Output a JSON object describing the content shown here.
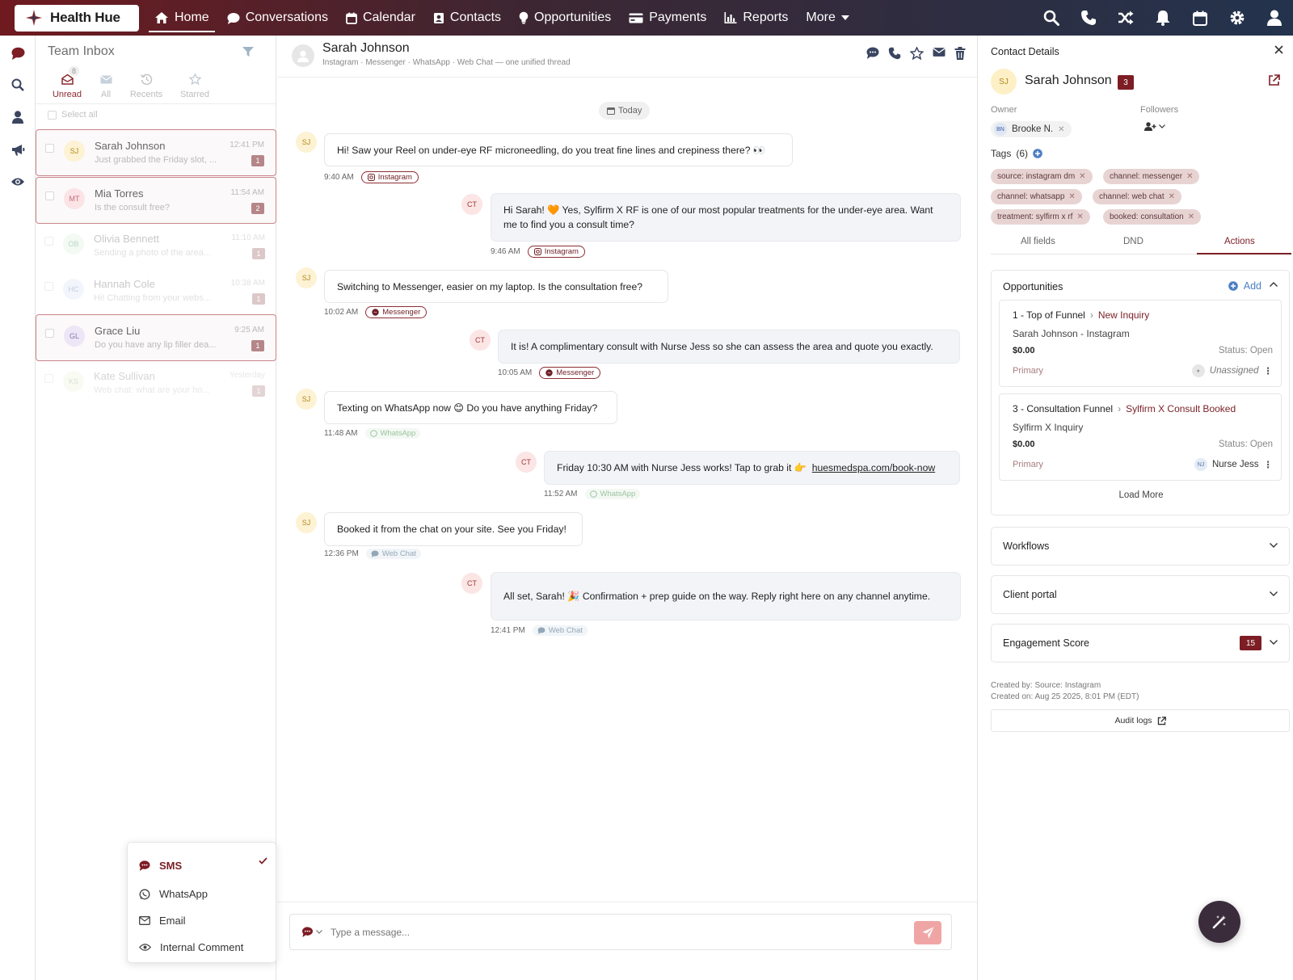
{
  "app": {
    "name": "Health Hue"
  },
  "nav": [
    {
      "label": "Home",
      "icon": "home-icon",
      "active": true
    },
    {
      "label": "Conversations",
      "icon": "chat-icon"
    },
    {
      "label": "Calendar",
      "icon": "calendar-icon"
    },
    {
      "label": "Contacts",
      "icon": "contacts-icon"
    },
    {
      "label": "Opportunities",
      "icon": "lightbulb-icon"
    },
    {
      "label": "Payments",
      "icon": "card-icon"
    },
    {
      "label": "Reports",
      "icon": "chart-icon"
    },
    {
      "label": "More",
      "icon": "caret-down-icon"
    }
  ],
  "inbox": {
    "title": "Team Inbox",
    "tabs": [
      {
        "label": "Unread",
        "badge": "8",
        "active": true
      },
      {
        "label": "All"
      },
      {
        "label": "Recents"
      },
      {
        "label": "Starred"
      }
    ],
    "select_all": "Select all",
    "conversations": [
      {
        "initials": "SJ",
        "name": "Sarah Johnson",
        "preview": "Just grabbed the Friday slot, ...",
        "time": "12:41 PM",
        "count": "1",
        "av_bg": "#fdf2d3",
        "av_fg": "#b08a1d"
      },
      {
        "initials": "MT",
        "name": "Mia Torres",
        "preview": "Is the consult free?",
        "time": "11:54 AM",
        "count": "2",
        "av_bg": "#fbe3e6",
        "av_fg": "#c26b78"
      },
      {
        "initials": "OB",
        "name": "Olivia Bennett",
        "preview": "Sending a photo of the area...",
        "time": "11:10 AM",
        "count": "1",
        "av_bg": "#e3f4e6",
        "av_fg": "#6aa57a"
      },
      {
        "initials": "HC",
        "name": "Hannah Cole",
        "preview": "Hi! Chatting from your webs...",
        "time": "10:38 AM",
        "count": "1",
        "av_bg": "#e3ebf7",
        "av_fg": "#7d93b8"
      },
      {
        "initials": "GL",
        "name": "Grace Liu",
        "preview": "Do you have any lip filler dea...",
        "time": "9:25 AM",
        "count": "1",
        "av_bg": "#ece6f6",
        "av_fg": "#8d7bb0"
      },
      {
        "initials": "KS",
        "name": "Kate Sullivan",
        "preview": "Web chat: what are your ho...",
        "time": "Yesterday",
        "count": "1",
        "av_bg": "#eef6df",
        "av_fg": "#93ad6b"
      }
    ]
  },
  "channel_menu": {
    "items": [
      {
        "label": "SMS",
        "icon": "sms-icon",
        "active": true
      },
      {
        "label": "WhatsApp",
        "icon": "whatsapp-icon"
      },
      {
        "label": "Email",
        "icon": "email-icon"
      },
      {
        "label": "Internal Comment",
        "icon": "eye-icon"
      }
    ]
  },
  "chat": {
    "contact_name": "Sarah Johnson",
    "subtitle": "Instagram · Messenger · WhatsApp · Web Chat — one unified thread",
    "date_divider": "Today",
    "messages": [
      {
        "from": "SJ",
        "dir": "in",
        "text": "Hi! Saw your Reel on under-eye RF microneedling, do you treat fine lines and crepiness there? 👀",
        "time": "9:40 AM",
        "channel": "Instagram"
      },
      {
        "from": "CT",
        "dir": "out",
        "text": "Hi Sarah! 🧡 Yes, Sylfirm X RF is one of our most popular treatments for the under-eye area. Want me to find you a consult time?",
        "time": "9:46 AM",
        "channel": "Instagram"
      },
      {
        "from": "SJ",
        "dir": "in",
        "text": "Switching to Messenger, easier on my laptop. Is the consultation free?",
        "time": "10:02 AM",
        "channel": "Messenger"
      },
      {
        "from": "CT",
        "dir": "out",
        "text": "It is! A complimentary consult with Nurse Jess so she can assess the area and quote you exactly.",
        "time": "10:05 AM",
        "channel": "Messenger"
      },
      {
        "from": "SJ",
        "dir": "in",
        "text": "Texting on WhatsApp now 😊 Do you have anything Friday?",
        "time": "11:48 AM",
        "channel": "WhatsApp"
      },
      {
        "from": "CT",
        "dir": "out",
        "text": "Friday 10:30 AM with Nurse Jess works! Tap to grab it 👉",
        "link": "huesmedspa.com/book-now",
        "time": "11:52 AM",
        "channel": "WhatsApp"
      },
      {
        "from": "SJ",
        "dir": "in",
        "text": "Booked it from the chat on your site. See you Friday!",
        "time": "12:36 PM",
        "channel": "Web Chat"
      },
      {
        "from": "CT",
        "dir": "out",
        "text": "All set, Sarah! 🎉 Confirmation + prep guide on the way. Reply right here on any channel anytime.",
        "time": "12:41 PM",
        "channel": "Web Chat"
      }
    ],
    "composer_placeholder": "Type a message..."
  },
  "panel": {
    "title": "Contact Details",
    "contact_initials": "SJ",
    "contact_name": "Sarah Johnson",
    "badge": "3",
    "owner_label": "Owner",
    "owner_initials": "BN",
    "owner_name": "Brooke N.",
    "followers_label": "Followers",
    "tags_title": "Tags",
    "tags_count": "(6)",
    "tags": [
      "source: instagram dm",
      "channel: messenger",
      "channel: whatsapp",
      "channel: web chat",
      "treatment: sylfirm x rf",
      "booked: consultation"
    ],
    "tabs": [
      "All fields",
      "DND",
      "Actions"
    ],
    "opportunities": {
      "title": "Opportunities",
      "add_label": "Add",
      "items": [
        {
          "pipeline": "1 - Top of Funnel",
          "stage": "New Inquiry",
          "name": "Sarah Johnson - Instagram",
          "value": "$0.00",
          "status": "Status: Open",
          "primary": "Primary",
          "assignee": "Unassigned",
          "assignee_initials": ""
        },
        {
          "pipeline": "3 - Consultation Funnel",
          "stage": "Sylfirm X Consult Booked",
          "name": "Sylfirm X Inquiry",
          "value": "$0.00",
          "status": "Status: Open",
          "primary": "Primary",
          "assignee": "Nurse Jess",
          "assignee_initials": "NJ"
        }
      ],
      "load_more": "Load More"
    },
    "workflows": "Workflows",
    "client_portal": "Client portal",
    "engagement": "Engagement Score",
    "engagement_value": "15",
    "created_by": "Created by: Source: Instagram",
    "created_on": "Created on: Aug 25 2025, 8:01 PM (EDT)",
    "audit_logs": "Audit logs"
  },
  "colors": {
    "brand": "#7a1f25",
    "accent_dark": "#23334d"
  }
}
